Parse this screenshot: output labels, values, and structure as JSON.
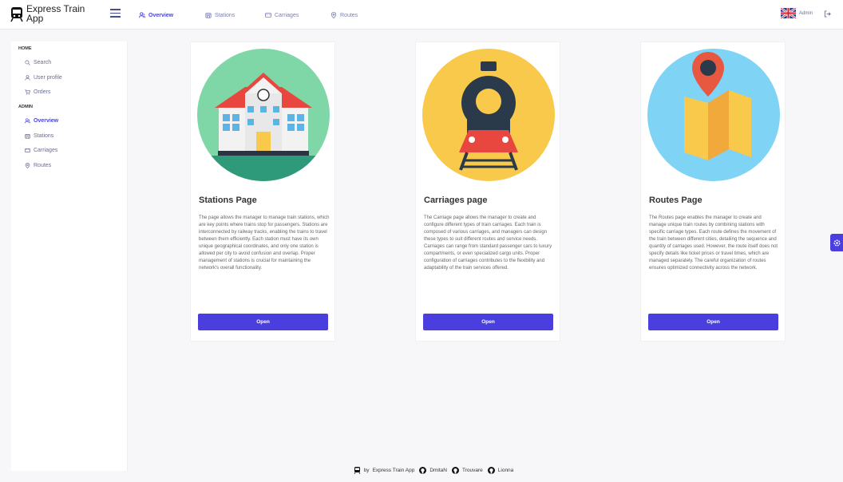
{
  "header": {
    "app_title": "Express Train App",
    "nav": [
      {
        "label": "Overview",
        "icon": "users-icon",
        "active": true
      },
      {
        "label": "Stations",
        "icon": "station-icon",
        "active": false
      },
      {
        "label": "Carriages",
        "icon": "carriage-icon",
        "active": false
      },
      {
        "label": "Routes",
        "icon": "pin-icon",
        "active": false
      }
    ],
    "user": "Admin",
    "flag": "uk-flag-icon"
  },
  "sidebar": {
    "home_section": "HOME",
    "home_items": [
      {
        "label": "Search",
        "icon": "search-icon"
      },
      {
        "label": "User profile",
        "icon": "user-icon"
      },
      {
        "label": "Orders",
        "icon": "cart-icon"
      }
    ],
    "admin_section": "ADMIN",
    "admin_items": [
      {
        "label": "Overview",
        "icon": "users-icon",
        "active": true
      },
      {
        "label": "Stations",
        "icon": "station-icon",
        "active": false
      },
      {
        "label": "Carriages",
        "icon": "carriage-icon",
        "active": false
      },
      {
        "label": "Routes",
        "icon": "pin-icon",
        "active": false
      }
    ]
  },
  "cards": [
    {
      "title": "Stations Page",
      "text": "The page allows the manager to manage train stations, which are key points where trains stop for passengers. Stations are interconnected by railway tracks, enabling the trains to travel between them efficiently. Each station must have its own unique geographical coordinates, and only one station is allowed per city to avoid confusion and overlap. Proper management of stations is crucial for maintaining the network's overall functionality.",
      "button": "Open",
      "image": "station-illustration",
      "circle_color": "#7fd6a6"
    },
    {
      "title": "Carriages page",
      "text": "The Carriage page allows the manager to create and configure different types of train carriages. Each train is composed of various carriages, and managers can design these types to suit different routes and service needs. Carriages can range from standard passenger cars to luxury compartments, or even specialized cargo units. Proper configuration of carriages contributes to the flexibility and adaptability of the train services offered.",
      "button": "Open",
      "image": "locomotive-illustration",
      "circle_color": "#f8c94a"
    },
    {
      "title": "Routes Page",
      "text": "The Routes page enables the manager to create and manage unique train routes by combining stations with specific carriage types. Each route defines the movement of the train between different cities, detailing the sequence and quantity of carriages used. However, the route itself does not specify details like ticket prices or travel times, which are managed separately. The careful organization of routes ensures optimized connectivity across the network.",
      "button": "Open",
      "image": "map-illustration",
      "circle_color": "#7fd3f5"
    }
  ],
  "footer": {
    "by": "by",
    "app": "Express Train App",
    "authors": [
      "DmitaN",
      "Trouvare",
      "Lionna"
    ]
  },
  "colors": {
    "accent": "#4a3fde",
    "nav_active": "#4a46d6"
  }
}
